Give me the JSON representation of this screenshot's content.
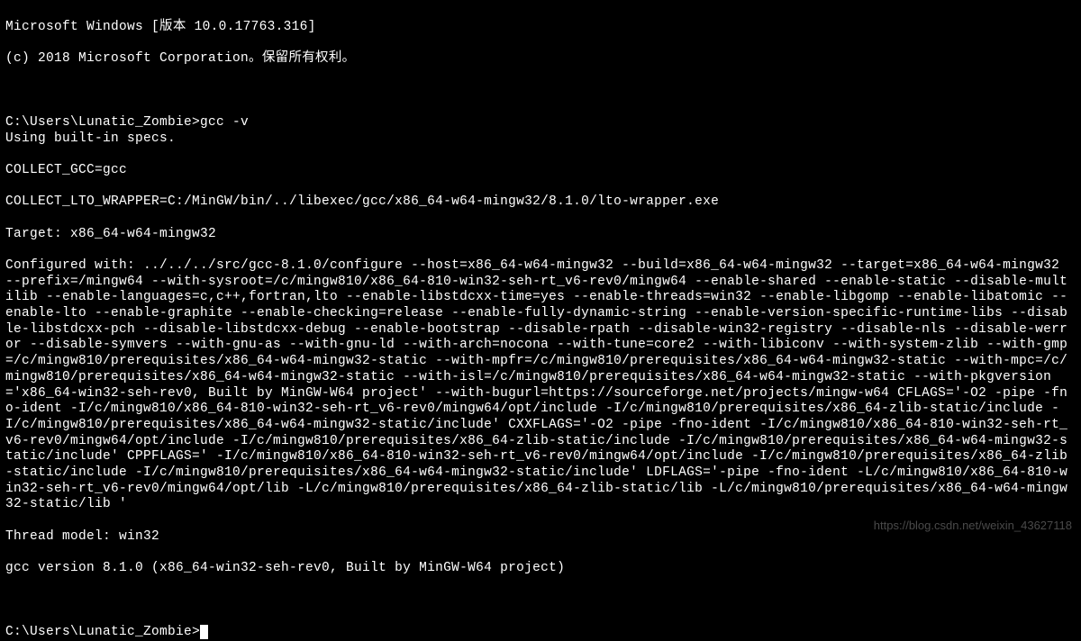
{
  "terminal": {
    "header_line1": "Microsoft Windows [版本 10.0.17763.316]",
    "header_line2": "(c) 2018 Microsoft Corporation。保留所有权利。",
    "prompt1_path": "C:\\Users\\Lunatic_Zombie>",
    "prompt1_command": "gcc -v",
    "output_line1": "Using built-in specs.",
    "output_line2": "COLLECT_GCC=gcc",
    "output_line3": "COLLECT_LTO_WRAPPER=C:/MinGW/bin/../libexec/gcc/x86_64-w64-mingw32/8.1.0/lto-wrapper.exe",
    "output_line4": "Target: x86_64-w64-mingw32",
    "output_configured": "Configured with: ../../../src/gcc-8.1.0/configure --host=x86_64-w64-mingw32 --build=x86_64-w64-mingw32 --target=x86_64-w64-mingw32 --prefix=/mingw64 --with-sysroot=/c/mingw810/x86_64-810-win32-seh-rt_v6-rev0/mingw64 --enable-shared --enable-static --disable-multilib --enable-languages=c,c++,fortran,lto --enable-libstdcxx-time=yes --enable-threads=win32 --enable-libgomp --enable-libatomic --enable-lto --enable-graphite --enable-checking=release --enable-fully-dynamic-string --enable-version-specific-runtime-libs --disable-libstdcxx-pch --disable-libstdcxx-debug --enable-bootstrap --disable-rpath --disable-win32-registry --disable-nls --disable-werror --disable-symvers --with-gnu-as --with-gnu-ld --with-arch=nocona --with-tune=core2 --with-libiconv --with-system-zlib --with-gmp=/c/mingw810/prerequisites/x86_64-w64-mingw32-static --with-mpfr=/c/mingw810/prerequisites/x86_64-w64-mingw32-static --with-mpc=/c/mingw810/prerequisites/x86_64-w64-mingw32-static --with-isl=/c/mingw810/prerequisites/x86_64-w64-mingw32-static --with-pkgversion='x86_64-win32-seh-rev0, Built by MinGW-W64 project' --with-bugurl=https://sourceforge.net/projects/mingw-w64 CFLAGS='-O2 -pipe -fno-ident -I/c/mingw810/x86_64-810-win32-seh-rt_v6-rev0/mingw64/opt/include -I/c/mingw810/prerequisites/x86_64-zlib-static/include -I/c/mingw810/prerequisites/x86_64-w64-mingw32-static/include' CXXFLAGS='-O2 -pipe -fno-ident -I/c/mingw810/x86_64-810-win32-seh-rt_v6-rev0/mingw64/opt/include -I/c/mingw810/prerequisites/x86_64-zlib-static/include -I/c/mingw810/prerequisites/x86_64-w64-mingw32-static/include' CPPFLAGS=' -I/c/mingw810/x86_64-810-win32-seh-rt_v6-rev0/mingw64/opt/include -I/c/mingw810/prerequisites/x86_64-zlib-static/include -I/c/mingw810/prerequisites/x86_64-w64-mingw32-static/include' LDFLAGS='-pipe -fno-ident -L/c/mingw810/x86_64-810-win32-seh-rt_v6-rev0/mingw64/opt/lib -L/c/mingw810/prerequisites/x86_64-zlib-static/lib -L/c/mingw810/prerequisites/x86_64-w64-mingw32-static/lib '",
    "output_thread": "Thread model: win32",
    "output_version": "gcc version 8.1.0 (x86_64-win32-seh-rev0, Built by MinGW-W64 project)",
    "prompt2_path": "C:\\Users\\Lunatic_Zombie>"
  },
  "watermark": "https://blog.csdn.net/weixin_43627118"
}
